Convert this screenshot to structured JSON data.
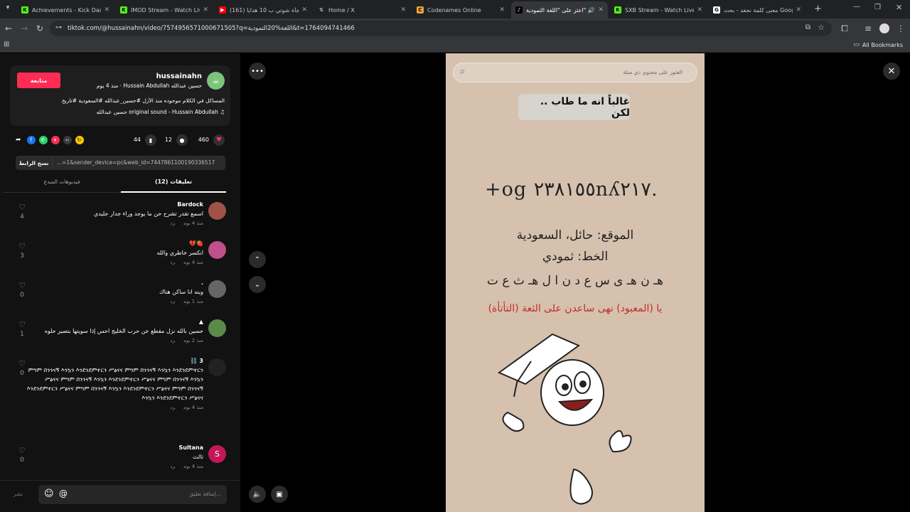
{
  "tabs": [
    {
      "title": "Achievements - Kick Dashbo",
      "icon": "kick-icon",
      "color": "#53fc18",
      "letter": "K"
    },
    {
      "title": "IMOD Stream - Watch Live o",
      "icon": "kick-icon",
      "color": "#53fc18",
      "letter": "K"
    },
    {
      "title": "(161) فاجأة شوتي ب 10 هدايا 🎁",
      "icon": "youtube-icon",
      "color": "#ff0000",
      "letter": "▶"
    },
    {
      "title": "Home / X",
      "icon": "x-icon",
      "color": "#202124",
      "letter": "𝕏"
    },
    {
      "title": "Codenames Online",
      "icon": "codenames-icon",
      "color": "#e8a33a",
      "letter": "C"
    },
    {
      "title": "اعثر على \"اللغة الثمودية\" 🔊",
      "icon": "tiktok-icon",
      "color": "#000000",
      "letter": "♪"
    },
    {
      "title": "SXB Stream - Watch Live on",
      "icon": "kick-icon",
      "color": "#53fc18",
      "letter": "K"
    },
    {
      "title": "معنى كلمة نحفد - بحث Google",
      "icon": "google-icon",
      "color": "#ffffff",
      "letter": "G"
    }
  ],
  "url": "tiktok.com/@hussainahn/video/7574956571000671505?q=اللغة%20الثمودية&t=1764094741466",
  "bookmarks_label": "All Bookmarks",
  "creator": {
    "username": "hussainahn",
    "display": "حسين عبدالله Hussain Abdullah · منذ 4 يوم",
    "follow_label": "متابعة",
    "caption": "المساكل في الكلام موجوده منذ الأزل #حسين_عبدالله #السعودية #تاريخ",
    "sound": "♫ original sound - Hussain Abdullah حسين عبدالله"
  },
  "stats": {
    "likes": "460",
    "comments": "12",
    "saves": "44"
  },
  "link": {
    "value": "...=1&sender_device=pc&web_id=7447861100190336517",
    "copy_label": "نسخ الرابط"
  },
  "panel_tabs": {
    "comments": "(12) تعليقات",
    "creator_videos": "فيديوهات المبدع"
  },
  "reply_label": "رد",
  "comments": [
    {
      "user": "Bardock",
      "text": "اسمع تقدر تشرح حن ما يوجد وراء جدار جليدي",
      "time": "منذ 4 يوم",
      "likes": "4",
      "avatar": "#a0524a"
    },
    {
      "user": "🍓💔",
      "text": "انكسر خاطري والله",
      "time": "منذ 4 يوم",
      "likes": "3",
      "avatar": "#c0508a"
    },
    {
      "user": ".",
      "text": "وينه انا ساكن هناك",
      "time": "منذ 1 يوم",
      "likes": "0",
      "avatar": "#666666"
    },
    {
      "user": "▲",
      "text": "حسين بالله نزل مقطع عن حرب الخليج احس إذا سويتها بتصير حلوه",
      "time": "منذ 2 يوم",
      "likes": "1",
      "avatar": "#5c8a4a"
    },
    {
      "user": "3 ⛓️",
      "text": "ምግም በንንናኝ እንኳን እንደንደምተርን ሥፅናና ምግም በንንናኝ እንኳን እንደንደምተርን ሥፅናና ምግም በንንናኝ እንኳን እንደንደምተርን ሥፅናና ምግም በንንናኝ እንኳን እንደንደምተርን ሥፅናና ምግም በንንናኝ እንኳን እንደንደምተርን ሥፅናና ምግም በንንናኝ እንኳን እንደንደምተርን ሥፅናና",
      "time": "منذ 4 يوم",
      "likes": "0",
      "avatar": "#222222"
    },
    {
      "user": "Sultana",
      "text": "ثالث",
      "time": "منذ 4 يوم",
      "likes": "0",
      "avatar": "#c2185b",
      "avatar_letter": "S"
    }
  ],
  "comment_input": {
    "placeholder": "إضافة تعليق...",
    "post_label": "نشر"
  },
  "video": {
    "search_placeholder": "العثور على محتوى ذي صلة",
    "caption": "غالباً انه ما طاب .. لكن",
    "glyphs": "+og ٢٣٨١٥٥nʎ٢١٧.",
    "location": "الموقع: حائل، السعودية",
    "script": "الخط: ثمودي",
    "transliteration": "هـ ن هـ ى   س ع د ن   ا ل   هـ ث ع ت",
    "translation": "يا (المعبود) نهى ساعدن على الثعة (التأتأة)"
  }
}
